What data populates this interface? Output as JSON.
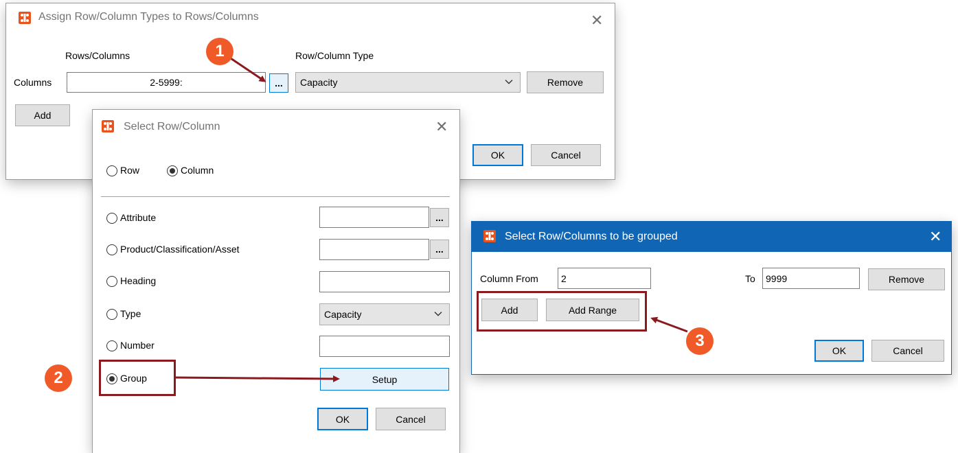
{
  "assign_dialog": {
    "title": "Assign Row/Column Types to Rows/Columns",
    "rows_columns_header": "Rows/Columns",
    "row_column_type_header": "Row/Column Type",
    "row_label": "Columns",
    "rows_columns_value": "2-5999:",
    "ellipsis_label": "...",
    "type_value": "Capacity",
    "remove_label": "Remove",
    "add_label": "Add",
    "ok_label": "OK",
    "cancel_label": "Cancel"
  },
  "select_dialog": {
    "title": "Select Row/Column",
    "row_label": "Row",
    "column_label": "Column",
    "selected_orientation": "Column",
    "options": [
      {
        "label": "Attribute"
      },
      {
        "label": "Product/Classification/Asset"
      },
      {
        "label": "Heading"
      },
      {
        "label": "Type"
      },
      {
        "label": "Number"
      },
      {
        "label": "Group"
      }
    ],
    "selected_option": "Group",
    "ellipsis_label": "...",
    "type_value": "Capacity",
    "setup_label": "Setup",
    "ok_label": "OK",
    "cancel_label": "Cancel"
  },
  "group_dialog": {
    "title": "Select Row/Columns to be grouped",
    "from_label": "Column From",
    "from_value": "2",
    "to_label": "To",
    "to_value": "9999",
    "remove_label": "Remove",
    "add_label": "Add",
    "add_range_label": "Add Range",
    "ok_label": "OK",
    "cancel_label": "Cancel"
  },
  "callouts": [
    "1",
    "2",
    "3"
  ],
  "colors": {
    "badge": "#f05a28",
    "highlight": "#8b1a1f",
    "active_titlebar": "#1066b5",
    "accent": "#0078d7"
  },
  "icons": {
    "app": "app-logo-icon",
    "close": "close-icon",
    "dropdown": "chevron-down-icon"
  }
}
